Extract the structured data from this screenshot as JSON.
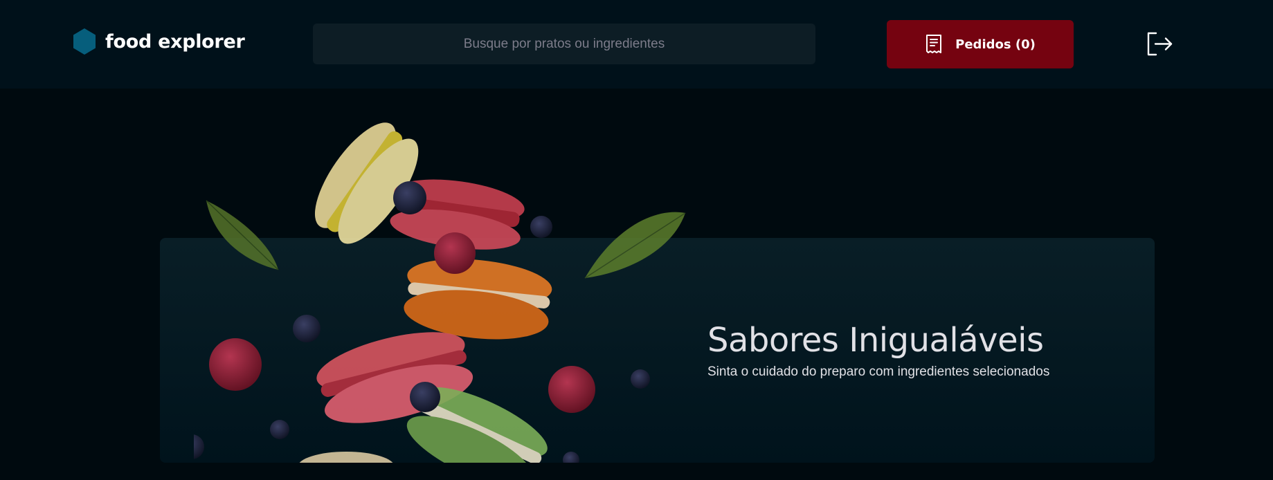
{
  "colors": {
    "background": "#000A0F",
    "header": "#00111A",
    "search_bg": "#0D1D25",
    "accent": "#750310",
    "banner_bg": "#091E26",
    "logo_blue": "#065E7C"
  },
  "header": {
    "logo": {
      "icon": "hexagon-icon",
      "text": "food explorer"
    },
    "search": {
      "placeholder": "Busque por pratos ou ingredientes",
      "value": ""
    },
    "orders_button": {
      "icon": "receipt-icon",
      "label": "Pedidos (0)"
    },
    "logout_button": {
      "icon": "sign-out-icon"
    }
  },
  "banner": {
    "image": "macarons-image",
    "title": "Sabores Inigualáveis",
    "subtitle": "Sinta o cuidado do preparo com ingredientes selecionados"
  }
}
